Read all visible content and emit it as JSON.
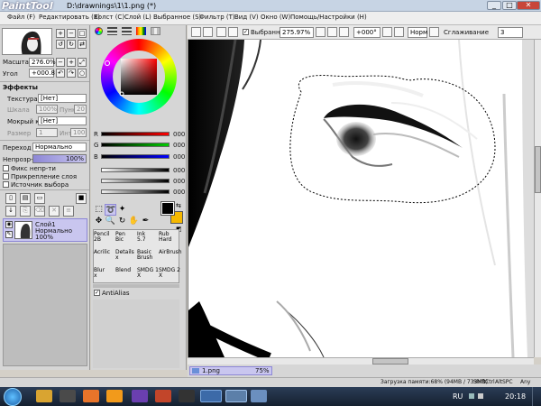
{
  "app": {
    "logo_text": "PaintTool SAI",
    "window_title": "D:\\drawnings\\1\\1.png (*)",
    "minimize": "_",
    "maximize": "□",
    "close": "✕"
  },
  "menu": [
    "Файл (F)",
    "Редактировать (E)",
    "Холст (C)",
    "Слой (L)",
    "Выбранное (S)",
    "Фильтр (T)",
    "Вид (V)",
    "Окно (W)",
    "Помощь/Настройки (H)"
  ],
  "navigator": {
    "zoom_label": "Масштаб",
    "zoom_value": "276.0%",
    "angle_label": "Угол",
    "angle_value": "+000.8"
  },
  "effects": {
    "header": "Эффекты",
    "texture_label": "Текстура",
    "texture_value": "[Нет]",
    "scale_label": "Шкала",
    "scale_value": "100%",
    "strength_label": "Пункт",
    "strength_value": "20",
    "wet_edge_label": "Мокрый край",
    "wet_edge_value": "[Нет]",
    "size_label": "Размер",
    "size_value": "1",
    "intensity_label": "Интенсивность",
    "intensity_value": "100"
  },
  "layer_panel": {
    "mode_label": "Переход",
    "mode_value": "Нормально",
    "opacity_label": "Непрозр-ть",
    "opacity_value": "100%",
    "fix_opacity": "Фикс непр-ти",
    "clip_group": "Прикрепление слоя",
    "selection_source": "Источник выбора",
    "layer_name": "Слой1",
    "layer_mode": "Нормально",
    "layer_opacity": "100%"
  },
  "color": {
    "r_label": "R",
    "g_label": "G",
    "b_label": "B",
    "r_value": "000",
    "g_value": "000",
    "b_value": "000",
    "hsv_1": "000",
    "hsv_2": "000",
    "hsv_3": "000",
    "fg": "#000000",
    "bg": "#f5b800"
  },
  "brushes": [
    {
      "name": "Pencil",
      "size": "2B"
    },
    {
      "name": "Pen",
      "size": "Bic"
    },
    {
      "name": "Ink",
      "size": "5.7"
    },
    {
      "name": "Rub",
      "size": "Hard"
    },
    {
      "name": "Acrilic",
      "size": ""
    },
    {
      "name": "Details",
      "size": "x"
    },
    {
      "name": "Basic",
      "size": "Brush"
    },
    {
      "name": "AirBrush",
      "size": ""
    },
    {
      "name": "Blur",
      "size": "x"
    },
    {
      "name": "Blend",
      "size": ""
    },
    {
      "name": "SMDG 1",
      "size": "X"
    },
    {
      "name": "SMDG 2",
      "size": "X"
    }
  ],
  "antialias_label": "AntiAlias",
  "toolbar": {
    "selection_label": "Выбранное",
    "zoom_value": "275.97%",
    "angle_value": "+000°",
    "mode_value": "Норм",
    "smoothing_label": "Сглаживание",
    "smoothing_value": "3"
  },
  "doc_tab": {
    "name": "1.png",
    "zoom": "75%"
  },
  "status": {
    "memory": "Загрузка памяти:68% (94MB / 733MB)",
    "keys": [
      "Shift",
      "Ctrl",
      "Alt",
      "SPC",
      "Any"
    ]
  },
  "taskbar": {
    "lang": "RU",
    "time": "20:18"
  }
}
